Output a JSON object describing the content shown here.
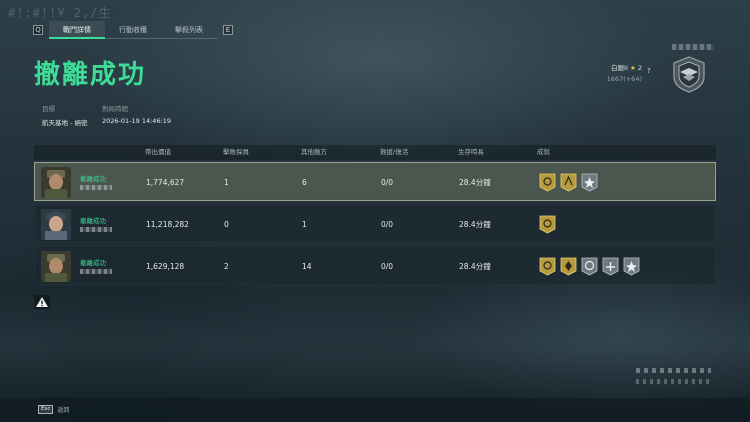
{
  "window": {
    "bg_noise": "#!:#!!¥ 2,/生"
  },
  "tabs": {
    "left_key": "Q",
    "right_key": "E",
    "items": [
      {
        "label": "戰鬥詳情",
        "active": true
      },
      {
        "label": "行動收穫",
        "active": false
      },
      {
        "label": "擊殺列表",
        "active": false
      }
    ]
  },
  "header": {
    "title": "撤離成功",
    "target_label": "目標",
    "target_value": "航天基地 - 絕密",
    "time_label": "對局時間",
    "time_value": "2026-01-19 14:46:19"
  },
  "player": {
    "rank_name": "白銀II",
    "stars": "2",
    "score": "1667(+64)",
    "help": "?"
  },
  "table": {
    "headers": [
      "帶出價值",
      "擊敗探員",
      "其他敵方",
      "救援/復活",
      "生存時長",
      "成就"
    ],
    "rows": [
      {
        "status": "撤離成功",
        "value": "1,774,627",
        "kills": "1",
        "others": "6",
        "rescue": "0/0",
        "time": "28.4分鐘",
        "medals": [
          "gold",
          "gold",
          "silver"
        ],
        "me": true
      },
      {
        "status": "撤離成功",
        "value": "11,218,282",
        "kills": "0",
        "others": "1",
        "rescue": "0/0",
        "time": "28.4分鐘",
        "medals": [
          "gold"
        ],
        "me": false
      },
      {
        "status": "撤離成功",
        "value": "1,629,128",
        "kills": "2",
        "others": "14",
        "rescue": "0/0",
        "time": "28.4分鐘",
        "medals": [
          "gold",
          "gold",
          "silver",
          "silver",
          "silver"
        ],
        "me": false
      }
    ]
  },
  "footer": {
    "esc_key": "Esc",
    "esc_label": "返回"
  },
  "colors": {
    "accent": "#3ddc97",
    "gold_medal": "#b89a3e",
    "silver_medal": "#6f7a80"
  }
}
